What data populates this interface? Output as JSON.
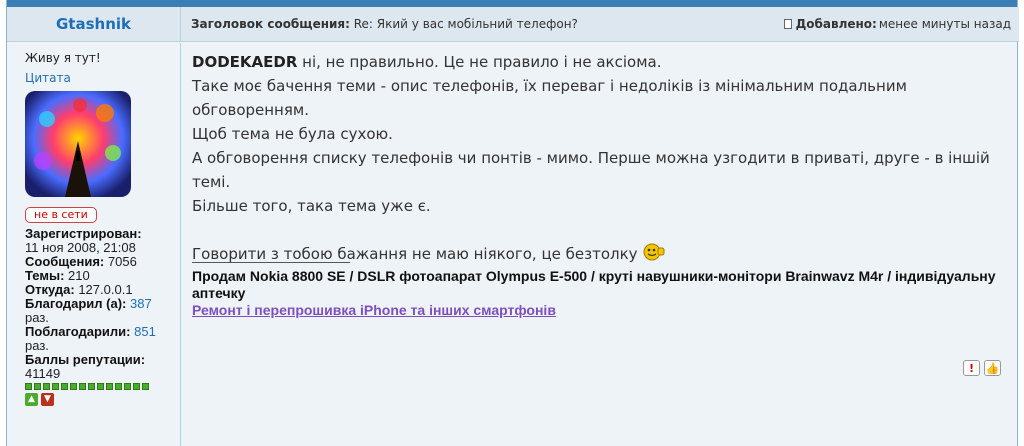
{
  "post_header": {
    "author": "Gtashnik",
    "subject_label": "Заголовок сообщения:",
    "subject_value": "Re: Який у вас мобільний телефон?",
    "added_label": "Добавлено:",
    "added_value": "менее минуты назад"
  },
  "user_panel": {
    "status_text": "Живу я тут!",
    "quote_link": "Цитата",
    "online_status": "не в сети",
    "registered_label": "Зарегистрирован:",
    "registered_value": "11 ноя 2008, 21:08",
    "messages_label": "Сообщения:",
    "messages_value": "7056",
    "topics_label": "Темы:",
    "topics_value": "210",
    "from_label": "Откуда:",
    "from_value": "127.0.0.1",
    "thanked_label": "Благодарил (а):",
    "thanked_value": "387",
    "thanked_suffix": "раз.",
    "was_thanked_label": "Поблагодарили:",
    "was_thanked_value": "851",
    "was_thanked_suffix": "раз.",
    "reputation_label": "Баллы репутации:",
    "reputation_value": "41149",
    "reputation_dots": 14
  },
  "post_body": {
    "nick": "DODEKAEDR",
    "line1_rest": " ні, не правильно. Це не правило і не аксіома.",
    "line2": "Таке моє бачення теми - опис телефонів, їх переваг і недоліків із мінімальним подальним обговоренням.",
    "line3": "Щоб тема не була сухою.",
    "line4": "А обговорення списку телефонів чи понтів - мимо. Перше можна узгодити в приваті, друге - в іншій темі.",
    "line5": "Більше того, така тема уже є.",
    "line6": "Говорити з тобою бажання не маю ніякого, це безтолку",
    "smile_icon": "thumbs-up-smiley-icon"
  },
  "signature": {
    "sale": "Продам Nokia 8800 SE / DSLR фотоапарат Olympus E-500 / круті навушники-монітори Brainwavz M4r / індивідуальну аптечку",
    "repair_link": "Ремонт і перепрошивка iPhone та інших смартфонів"
  },
  "actions": {
    "report_icon": "report-icon",
    "thanks_icon": "thumbs-up-icon"
  },
  "colors": {
    "accent": "#3a7eb3",
    "link": "#1d6eb6",
    "signature_link": "#7e4fbf"
  }
}
